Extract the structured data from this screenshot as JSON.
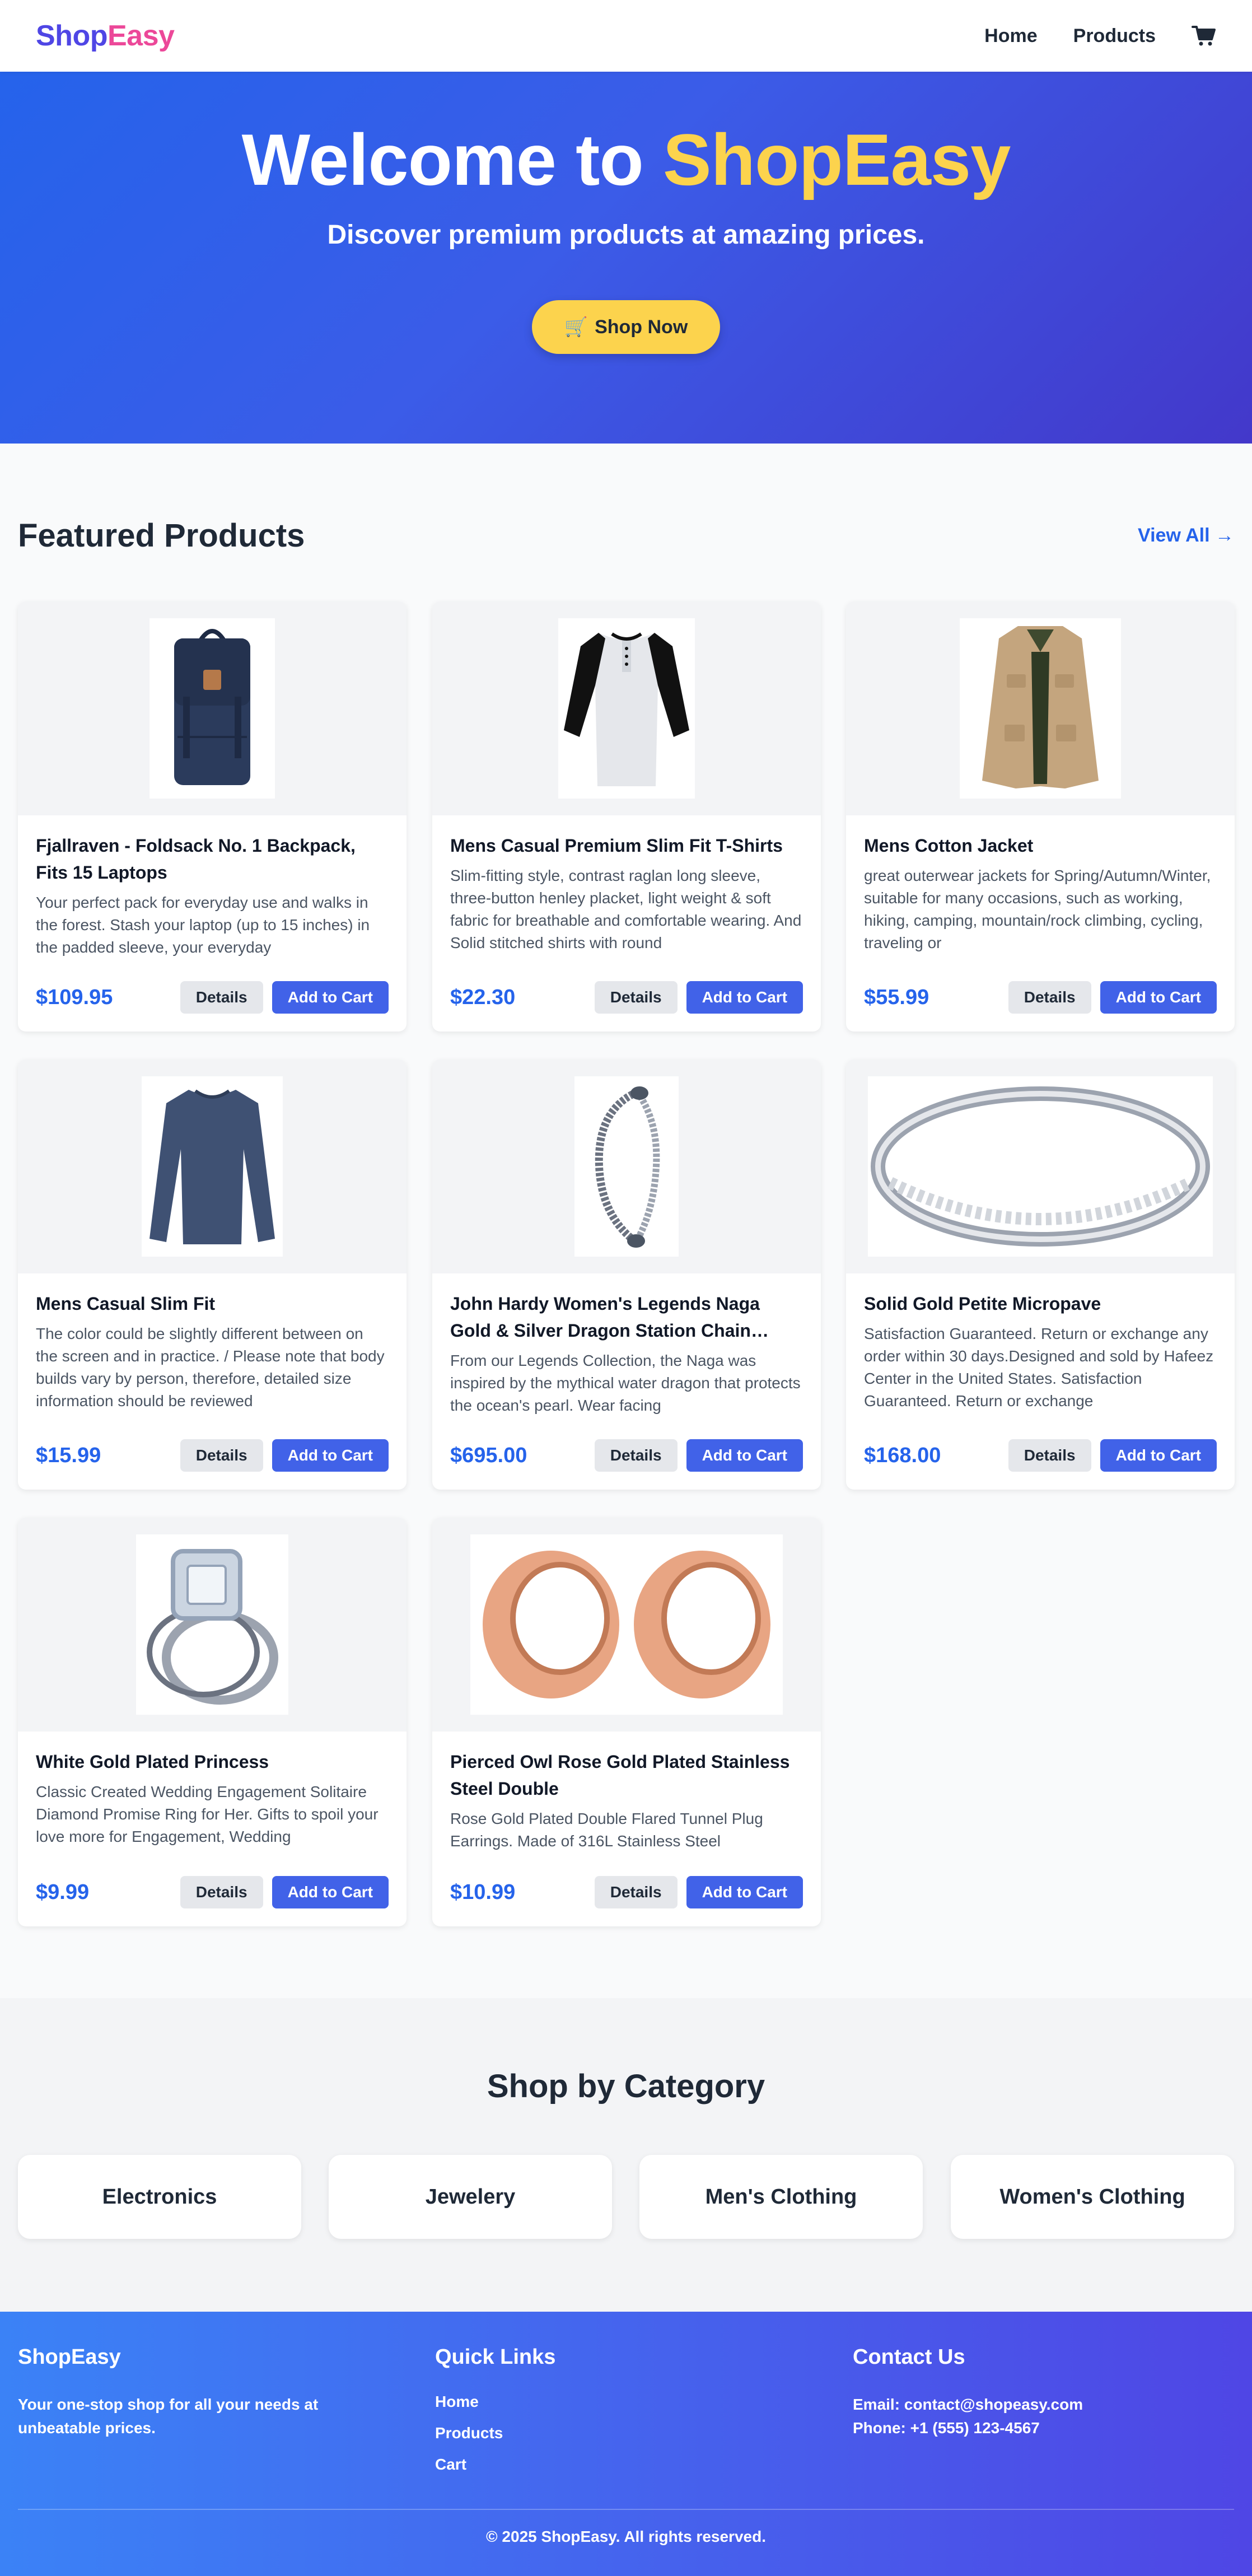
{
  "navbar": {
    "brand_part1": "Shop",
    "brand_part2": "Easy",
    "links": [
      "Home",
      "Products"
    ],
    "cart_icon": "shopping-cart-icon"
  },
  "hero": {
    "title_prefix": "Welcome to ",
    "title_highlight": "ShopEasy",
    "subtitle": "Discover premium products at amazing prices.",
    "button_icon": "🛒",
    "button_label": "Shop Now"
  },
  "featured": {
    "title": "Featured Products",
    "view_all": "View All →",
    "details_label": "Details",
    "cart_label": "Add to Cart",
    "products": [
      {
        "title": "Fjallraven - Foldsack No. 1 Backpack, Fits 15 Laptops",
        "desc": "Your perfect pack for everyday use and walks in the forest. Stash your laptop (up to 15 inches) in the padded sleeve, your everyday",
        "price": "$109.95",
        "image": "backpack"
      },
      {
        "title": "Mens Casual Premium Slim Fit T-Shirts",
        "desc": "Slim-fitting style, contrast raglan long sleeve, three-button henley placket, light weight & soft fabric for breathable and comfortable wearing. And Solid stitched shirts with round",
        "price": "$22.30",
        "image": "raglan-shirt"
      },
      {
        "title": "Mens Cotton Jacket",
        "desc": "great outerwear jackets for Spring/Autumn/Winter, suitable for many occasions, such as working, hiking, camping, mountain/rock climbing, cycling, traveling or",
        "price": "$55.99",
        "image": "cotton-jacket"
      },
      {
        "title": "Mens Casual Slim Fit",
        "desc": "The color could be slightly different between on the screen and in practice. / Please note that body builds vary by person, therefore, detailed size information should be reviewed",
        "price": "$15.99",
        "image": "long-sleeve-shirt"
      },
      {
        "title": "John Hardy Women's Legends Naga Gold & Silver Dragon Station Chain Bracelet",
        "desc": "From our Legends Collection, the Naga was inspired by the mythical water dragon that protects the ocean's pearl. Wear facing",
        "price": "$695.00",
        "image": "dragon-bracelet"
      },
      {
        "title": "Solid Gold Petite Micropave",
        "desc": "Satisfaction Guaranteed. Return or exchange any order within 30 days.Designed and sold by Hafeez Center in the United States. Satisfaction Guaranteed. Return or exchange",
        "price": "$168.00",
        "image": "micropave-ring"
      },
      {
        "title": "White Gold Plated Princess",
        "desc": "Classic Created Wedding Engagement Solitaire Diamond Promise Ring for Her. Gifts to spoil your love more for Engagement, Wedding",
        "price": "$9.99",
        "image": "princess-ring"
      },
      {
        "title": "Pierced Owl Rose Gold Plated Stainless Steel Double",
        "desc": "Rose Gold Plated Double Flared Tunnel Plug Earrings. Made of 316L Stainless Steel",
        "price": "$10.99",
        "image": "tunnel-plugs"
      }
    ]
  },
  "categories": {
    "title": "Shop by Category",
    "items": [
      "Electronics",
      "Jewelery",
      "Men's Clothing",
      "Women's Clothing"
    ]
  },
  "footer": {
    "brand": "ShopEasy",
    "tagline": "Your one-stop shop for all your needs at unbeatable prices.",
    "links_title": "Quick Links",
    "links": [
      "Home",
      "Products",
      "Cart"
    ],
    "contact_title": "Contact Us",
    "email": "Email: contact@shopeasy.com",
    "phone": "Phone: +1 (555) 123-4567",
    "copyright": "© 2025 ShopEasy. All rights reserved."
  },
  "colors": {
    "accent": "#2563eb",
    "brand_indigo": "#4f46e5",
    "brand_pink": "#ec4899",
    "highlight_yellow": "#fcd34d",
    "cart_button": "#4162e8"
  }
}
